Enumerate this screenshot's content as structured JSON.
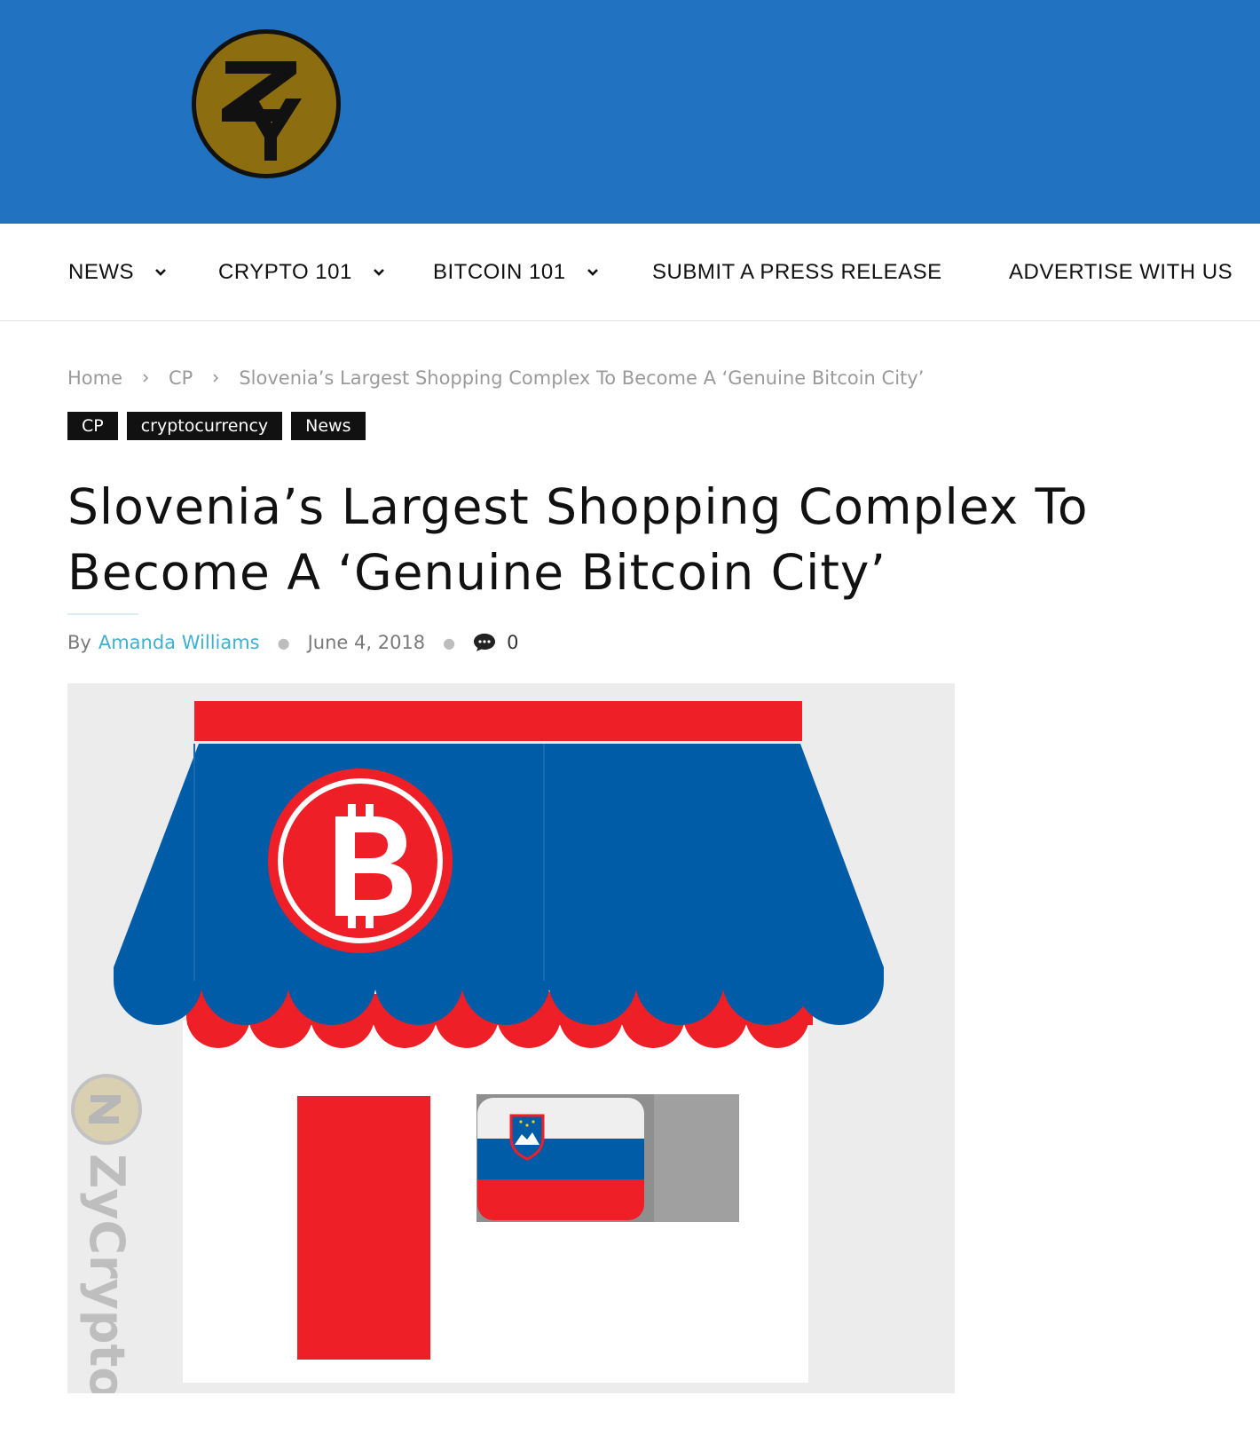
{
  "header": {
    "logo_icon": "zycrypto-logo-icon",
    "logo_letters": "ZY",
    "background_color": "#2172c1"
  },
  "nav": {
    "items": [
      {
        "label": "NEWS",
        "has_dropdown": true
      },
      {
        "label": "CRYPTO 101",
        "has_dropdown": true
      },
      {
        "label": "BITCOIN 101",
        "has_dropdown": true
      },
      {
        "label": "SUBMIT A PRESS RELEASE",
        "has_dropdown": false
      },
      {
        "label": "ADVERTISE WITH US",
        "has_dropdown": false
      }
    ]
  },
  "breadcrumb": {
    "items": [
      "Home",
      "CP",
      "Slovenia’s Largest Shopping Complex To Become A ‘Genuine Bitcoin City’"
    ]
  },
  "tags": [
    "CP",
    "cryptocurrency",
    "News"
  ],
  "article": {
    "title_line1": "Slovenia’s Largest Shopping Complex To",
    "title_line2": "Become A ‘Genuine Bitcoin City’",
    "by_label": "By",
    "author": "Amanda Williams",
    "date": "June 4, 2018",
    "comment_count": "0",
    "comment_icon": "comment-bubble-icon"
  },
  "featured_image": {
    "description_icon": "bitcoin-store-illustration",
    "watermark_text": "ZyCrypto",
    "watermark_icon": "zycrypto-watermark-icon",
    "colors": {
      "awning_blue": "#005ca6",
      "red": "#ee1f26",
      "background": "#ececec"
    }
  }
}
